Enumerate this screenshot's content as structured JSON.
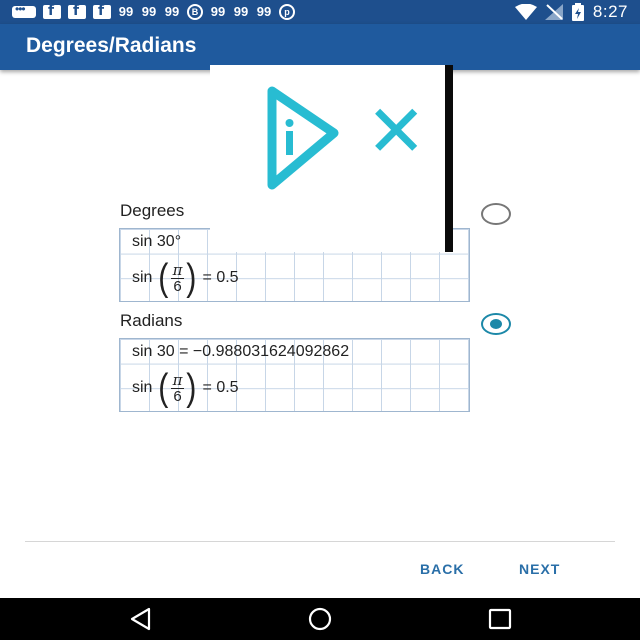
{
  "status_bar": {
    "time": "8:27",
    "notification_icons": [
      "chat-icon",
      "facebook-icon",
      "facebook-icon",
      "facebook-icon",
      "quote-icon",
      "quote-icon",
      "quote-icon",
      "b-circle-icon",
      "quote-icon",
      "quote-icon",
      "quote-icon",
      "pinterest-icon"
    ],
    "system_icons": [
      "wifi-icon",
      "no-signal-icon",
      "battery-charging-icon"
    ]
  },
  "toolbar": {
    "title": "Degrees/Radians"
  },
  "options": [
    {
      "label": "Degrees",
      "selected": false,
      "line1": "sin 30°",
      "line2_prefix": "sin",
      "line2_num": "π",
      "line2_den": "6",
      "line2_suffix": "= 0.5"
    },
    {
      "label": "Radians",
      "selected": true,
      "line1": "sin 30 = −0.988031624092862",
      "line2_prefix": "sin",
      "line2_num": "π",
      "line2_den": "6",
      "line2_suffix": "= 0.5"
    }
  ],
  "ad": {
    "icons": [
      "adchoices-play-icon",
      "ad-close-icon"
    ],
    "accent": "#28bcd2"
  },
  "footer": {
    "back_label": "BACK",
    "next_label": "NEXT"
  },
  "nav_bar": {
    "icons": [
      "back-triangle-icon",
      "home-circle-icon",
      "recents-square-icon"
    ]
  },
  "colors": {
    "app_bar": "#1f5a9e",
    "status_bar": "#1e4f8d",
    "accent_radio": "#1c88a8",
    "button_text": "#2a6fa8"
  }
}
